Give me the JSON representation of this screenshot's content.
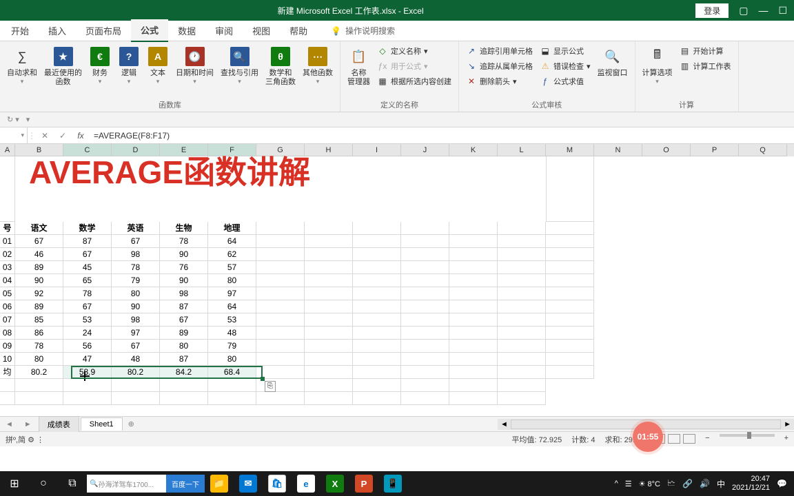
{
  "title_bar": {
    "document_title": "新建 Microsoft Excel 工作表.xlsx  -  Excel",
    "login": "登录"
  },
  "ribbon_tabs": [
    "开始",
    "插入",
    "页面布局",
    "公式",
    "数据",
    "审阅",
    "视图",
    "帮助"
  ],
  "ribbon_active_index": 3,
  "search_hint": "操作说明搜索",
  "ribbon": {
    "group1": {
      "autosum": "自动求和",
      "recent": "最近使用的\n函数",
      "financial": "财务",
      "logical": "逻辑",
      "text": "文本",
      "datetime": "日期和时间",
      "lookup": "查找与引用",
      "math": "数学和\n三角函数",
      "more": "其他函数",
      "label": "函数库"
    },
    "group2": {
      "name_mgr": "名称\n管理器",
      "define": "定义名称",
      "use_in_formula": "用于公式",
      "create_from": "根据所选内容创建",
      "label": "定义的名称"
    },
    "group3": {
      "trace_prec": "追踪引用单元格",
      "trace_dep": "追踪从属单元格",
      "remove_arrows": "删除箭头",
      "show_formulas": "显示公式",
      "error_check": "错误检查",
      "evaluate": "公式求值",
      "watch": "监视窗口",
      "label": "公式审核"
    },
    "group4": {
      "calc_opts": "计算选项",
      "calc_now": "开始计算",
      "calc_sheet": "计算工作表",
      "label": "计算"
    }
  },
  "formula_bar": {
    "name_box": "",
    "formula": "=AVERAGE(F8:F17)"
  },
  "columns": [
    "A",
    "B",
    "C",
    "D",
    "E",
    "F",
    "G",
    "H",
    "I",
    "J",
    "K",
    "L",
    "M",
    "N",
    "O",
    "P",
    "Q"
  ],
  "selected_cols": [
    "C",
    "D",
    "E",
    "F"
  ],
  "big_title": "AVERAGE函数讲解",
  "table": {
    "headers": [
      "号",
      "语文",
      "数学",
      "英语",
      "生物",
      "地理"
    ],
    "rows": [
      [
        "01",
        "67",
        "87",
        "67",
        "78",
        "64"
      ],
      [
        "02",
        "46",
        "67",
        "98",
        "90",
        "62"
      ],
      [
        "03",
        "89",
        "45",
        "78",
        "76",
        "57"
      ],
      [
        "04",
        "90",
        "65",
        "79",
        "90",
        "80"
      ],
      [
        "05",
        "92",
        "78",
        "80",
        "98",
        "97"
      ],
      [
        "06",
        "89",
        "67",
        "90",
        "87",
        "64"
      ],
      [
        "07",
        "85",
        "53",
        "98",
        "67",
        "53"
      ],
      [
        "08",
        "86",
        "24",
        "97",
        "89",
        "48"
      ],
      [
        "09",
        "78",
        "56",
        "67",
        "80",
        "79"
      ],
      [
        "10",
        "80",
        "47",
        "48",
        "87",
        "80"
      ]
    ],
    "avg_row": [
      "均分",
      "80.2",
      "58.9",
      "80.2",
      "84.2",
      "68.4"
    ]
  },
  "autofill_icon": "⎘",
  "sheets": {
    "tabs": [
      "成绩表",
      "Sheet1"
    ],
    "active_index": 1
  },
  "status": {
    "avg_label": "平均值:",
    "avg_val": "72.925",
    "count_label": "计数:",
    "count_val": "4",
    "sum_label": "求和:",
    "sum_val": "291.7"
  },
  "timer": "01:55",
  "taskbar": {
    "search_placeholder": "孙海洋驾车1700...",
    "search_btn": "百度一下",
    "weather": "8°C",
    "time": "20:47",
    "date": "2021/12/21"
  },
  "chart_data": {
    "type": "table",
    "title": "AVERAGE函数讲解",
    "columns": [
      "号",
      "语文",
      "数学",
      "英语",
      "生物",
      "地理"
    ],
    "rows": [
      {
        "号": "01",
        "语文": 67,
        "数学": 87,
        "英语": 67,
        "生物": 78,
        "地理": 64
      },
      {
        "号": "02",
        "语文": 46,
        "数学": 67,
        "英语": 98,
        "生物": 90,
        "地理": 62
      },
      {
        "号": "03",
        "语文": 89,
        "数学": 45,
        "英语": 78,
        "生物": 76,
        "地理": 57
      },
      {
        "号": "04",
        "语文": 90,
        "数学": 65,
        "英语": 79,
        "生物": 90,
        "地理": 80
      },
      {
        "号": "05",
        "语文": 92,
        "数学": 78,
        "英语": 80,
        "生物": 98,
        "地理": 97
      },
      {
        "号": "06",
        "语文": 89,
        "数学": 67,
        "英语": 90,
        "生物": 87,
        "地理": 64
      },
      {
        "号": "07",
        "语文": 85,
        "数学": 53,
        "英语": 98,
        "生物": 67,
        "地理": 53
      },
      {
        "号": "08",
        "语文": 86,
        "数学": 24,
        "英语": 97,
        "生物": 89,
        "地理": 48
      },
      {
        "号": "09",
        "语文": 78,
        "数学": 56,
        "英语": 67,
        "生物": 80,
        "地理": 79
      },
      {
        "号": "10",
        "语文": 80,
        "数学": 47,
        "英语": 48,
        "生物": 87,
        "地理": 80
      }
    ],
    "averages": {
      "语文": 80.2,
      "数学": 58.9,
      "英语": 80.2,
      "生物": 84.2,
      "地理": 68.4
    }
  }
}
